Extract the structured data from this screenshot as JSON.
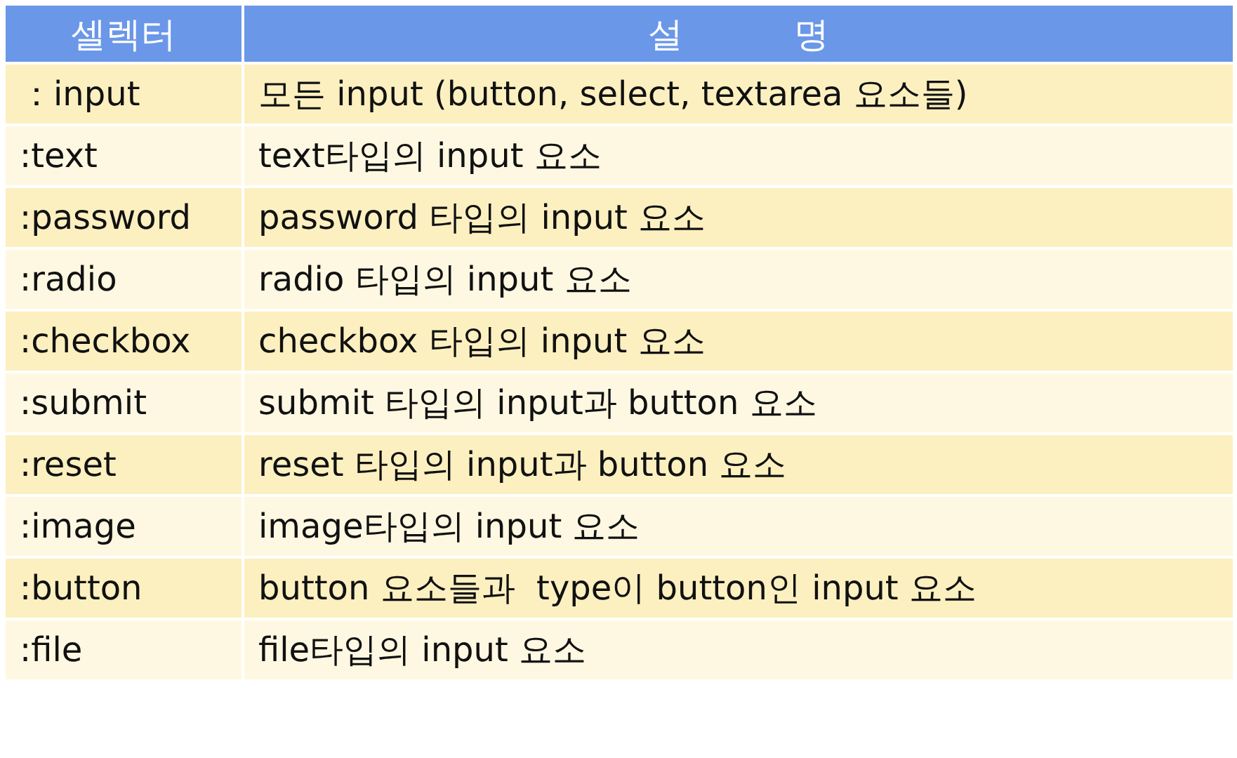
{
  "table": {
    "columns": [
      "셀렉터",
      "설          명"
    ],
    "rows": [
      [
        "：input",
        "모든 input (button, select, textarea 요소들)"
      ],
      [
        ":text",
        "text타입의 input 요소"
      ],
      [
        ":password",
        "password 타입의 input 요소"
      ],
      [
        ":radio",
        "radio 타입의 input 요소"
      ],
      [
        ":checkbox",
        "checkbox 타입의 input 요소"
      ],
      [
        ":submit",
        "submit 타입의 input과 button 요소"
      ],
      [
        ":reset",
        "reset 타입의 input과 button 요소"
      ],
      [
        ":image",
        "image타입의 input 요소"
      ],
      [
        ":button",
        "button 요소들과  type이 button인 input 요소"
      ],
      [
        ":file",
        "file타입의 input 요소"
      ]
    ]
  }
}
